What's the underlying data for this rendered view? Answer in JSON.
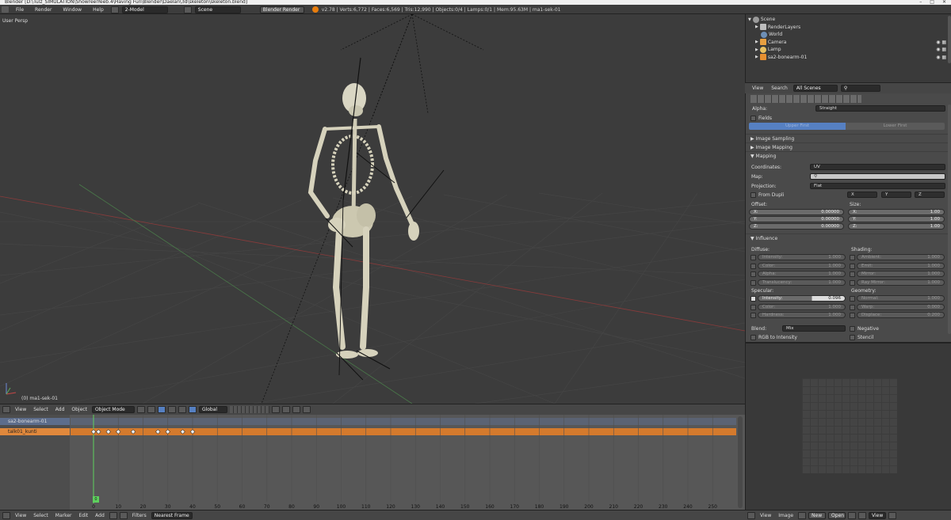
{
  "titlebar": {
    "text": "Blender [D:\\Tulz_SIMULATION\\ShowreelYeeb.4\\Having Fun\\Blender\\Daelan\\3d\\skeleton\\skeleton.blend]"
  },
  "menu": {
    "file": "File",
    "render": "Render",
    "window": "Window",
    "help": "Help"
  },
  "screen_layout": "2-Model",
  "scene_field": "Scene",
  "render_engine": "Blender Render",
  "stats": "v2.78 | Verts:6,772 | Faces:6,569 | Tris:12,990 | Objects:0/4 | Lamps:0/1 | Mem:95.63M | ma1-sek-01",
  "viewport": {
    "label": "User Persp",
    "object_label": "(0) ma1-sek-01"
  },
  "viewport_header": {
    "view": "View",
    "select": "Select",
    "add": "Add",
    "object": "Object",
    "mode": "Object Mode",
    "orientation": "Global"
  },
  "outliner": {
    "items": [
      {
        "label": "Scene"
      },
      {
        "label": "RenderLayers"
      },
      {
        "label": "World"
      },
      {
        "label": "Camera"
      },
      {
        "label": "Lamp"
      },
      {
        "label": "sa2-bonearm-01"
      }
    ],
    "header": {
      "view": "View",
      "search": "Search",
      "filter": "All Scenes"
    }
  },
  "properties": {
    "alpha_label": "Alpha:",
    "alpha_value": "Straight",
    "fields_label": "Fields",
    "upper_first": "Upper First",
    "lower_first": "Lower First",
    "image_sampling": "Image Sampling",
    "image_mapping": "Image Mapping",
    "mapping": "Mapping",
    "coordinates_label": "Coordinates:",
    "coordinates_value": "UV",
    "map_label": "Map:",
    "projection_label": "Projection:",
    "projection_value": "Flat",
    "from_dupli": "From Dupli",
    "axis_x": "X",
    "axis_y": "Y",
    "axis_z": "Z",
    "offset_label": "Offset:",
    "size_label": "Size:",
    "offset": [
      {
        "axis": "X:",
        "value": "0.00000"
      },
      {
        "axis": "Y:",
        "value": "0.00000"
      },
      {
        "axis": "Z:",
        "value": "0.00000"
      }
    ],
    "size": [
      {
        "axis": "X:",
        "value": "1.00"
      },
      {
        "axis": "Y:",
        "value": "1.00"
      },
      {
        "axis": "Z:",
        "value": "1.00"
      }
    ],
    "influence": "Influence",
    "diffuse_label": "Diffuse:",
    "shading_label": "Shading:",
    "diffuse": [
      {
        "label": "Intensity:",
        "value": "1.000"
      },
      {
        "label": "Color:",
        "value": "1.000"
      },
      {
        "label": "Alpha:",
        "value": "1.000"
      },
      {
        "label": "Translucency:",
        "value": "1.000"
      }
    ],
    "shading": [
      {
        "label": "Ambient:",
        "value": "1.000"
      },
      {
        "label": "Emit:",
        "value": "1.000"
      },
      {
        "label": "Mirror:",
        "value": "1.000"
      },
      {
        "label": "Ray Mirror:",
        "value": "1.000"
      }
    ],
    "specular_label": "Specular:",
    "geometry_label": "Geometry:",
    "specular": [
      {
        "label": "Intensity:",
        "value": "0.096"
      },
      {
        "label": "Color:",
        "value": "1.000"
      },
      {
        "label": "Hardness:",
        "value": "1.000"
      }
    ],
    "geometry": [
      {
        "label": "Normal:",
        "value": "1.000"
      },
      {
        "label": "Warp:",
        "value": "0.000"
      },
      {
        "label": "Displace:",
        "value": "0.200"
      }
    ],
    "blend_label": "Blend:",
    "blend_value": "Mix",
    "negative": "Negative",
    "rgb_to_intensity": "RGB to Intensity",
    "stencil": "Stencil"
  },
  "dopesheet": {
    "channels": [
      {
        "label": "sa2-bonearm-01"
      },
      {
        "label": "talk01_kunti"
      }
    ],
    "current_frame": "0",
    "ruler": [
      "0",
      "10",
      "20",
      "30",
      "40",
      "50",
      "60",
      "70",
      "80",
      "90",
      "100",
      "110",
      "120",
      "130",
      "140",
      "150",
      "160",
      "170",
      "180",
      "190",
      "200",
      "210",
      "220",
      "230",
      "240",
      "250"
    ],
    "keyframes": [
      0,
      2,
      6,
      10,
      16,
      26,
      30,
      36,
      40
    ]
  },
  "dopesheet_header": {
    "view": "View",
    "select": "Select",
    "marker": "Marker",
    "edit": "Edit",
    "add": "Add",
    "filters": "Filters",
    "snap": "Nearest Frame"
  },
  "image_editor_header": {
    "view": "View",
    "image": "Image",
    "new": "New",
    "open": "Open",
    "view2": "View"
  },
  "colors": {
    "accent": "#5680c2",
    "orange_channel": "#d47a2d",
    "selected_object": "#f0a030",
    "frame_indicator": "#5ed05e"
  }
}
